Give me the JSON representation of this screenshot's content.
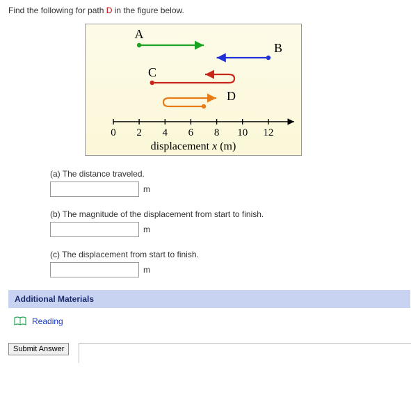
{
  "prompt": {
    "before": "Find the following for path ",
    "path": "D",
    "after": " in the figure below."
  },
  "figure": {
    "labels": {
      "A": "A",
      "B": "B",
      "C": "C",
      "D": "D"
    },
    "axis_label": "displacement x (m)",
    "ticks": [
      "0",
      "2",
      "4",
      "6",
      "8",
      "10",
      "12"
    ]
  },
  "parts": {
    "a": {
      "label": "(a) The distance traveled.",
      "unit": "m"
    },
    "b": {
      "label": "(b) The magnitude of the displacement from start to finish.",
      "unit": "m"
    },
    "c": {
      "label": "(c) The displacement from start to finish.",
      "unit": "m"
    }
  },
  "additional": {
    "header": "Additional Materials",
    "reading": "Reading"
  },
  "submit": {
    "label": "Submit Answer"
  },
  "chart_data": {
    "type": "line",
    "title": "Paths on displacement axis",
    "xlabel": "displacement x (m)",
    "ylabel": "",
    "xlim": [
      0,
      14
    ],
    "series": [
      {
        "name": "A",
        "x": [
          2,
          7
        ],
        "color": "#1aa321"
      },
      {
        "name": "B",
        "x": [
          12,
          8
        ],
        "color": "#2030d8"
      },
      {
        "name": "C",
        "x": [
          3,
          7,
          9,
          7
        ],
        "color": "#c9261a"
      },
      {
        "name": "D",
        "x": [
          7,
          4,
          8
        ],
        "color": "#e77b17"
      }
    ],
    "ticks_x": [
      0,
      2,
      4,
      6,
      8,
      10,
      12
    ]
  }
}
